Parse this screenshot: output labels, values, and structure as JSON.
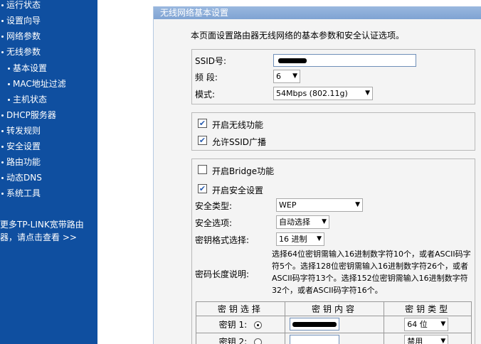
{
  "sidebar": {
    "items": [
      {
        "label": "运行状态"
      },
      {
        "label": "设置向导"
      },
      {
        "label": "网络参数"
      },
      {
        "label": "无线参数"
      },
      {
        "label": "基本设置"
      },
      {
        "label": "MAC地址过滤"
      },
      {
        "label": "主机状态"
      },
      {
        "label": "DHCP服务器"
      },
      {
        "label": "转发规则"
      },
      {
        "label": "安全设置"
      },
      {
        "label": "路由功能"
      },
      {
        "label": "动态DNS"
      },
      {
        "label": "系统工具"
      }
    ],
    "promo_line1": "更多TP-LINK宽带路由",
    "promo_line2": "器，请点击查看 >>"
  },
  "panel": {
    "title": "无线网络基本设置",
    "intro": "本页面设置路由器无线网络的基本参数和安全认证选项。",
    "ssid_label": "SSID号:",
    "ssid_value": "",
    "channel_label": "频 段:",
    "channel_value": "6",
    "mode_label": "模式:",
    "mode_value": "54Mbps (802.11g)",
    "enable_wireless_label": "开启无线功能",
    "enable_wireless_checked": true,
    "ssid_broadcast_label": "允许SSID广播",
    "ssid_broadcast_checked": true,
    "bridge_label": "开启Bridge功能",
    "bridge_checked": false,
    "security_label": "开启安全设置",
    "security_checked": true,
    "security_type_label": "安全类型:",
    "security_type_value": "WEP",
    "security_option_label": "安全选项:",
    "security_option_value": "自动选择",
    "key_format_label": "密钥格式选择:",
    "key_format_value": "16 进制",
    "key_length_label": "密码长度说明:",
    "key_length_desc": "选择64位密钥需输入16进制数字符10个，或者ASCII码字符5个。选择128位密钥需输入16进制数字符26个，或者ASCII码字符13个。选择152位密钥需输入16进制数字符32个，或者ASCII码字符16个。",
    "key_table": {
      "col_select": "密钥选择",
      "col_content": "密钥内容",
      "col_type": "密钥类型",
      "rows": [
        {
          "label": "密钥 1:",
          "selected": true,
          "type": "64 位"
        },
        {
          "label": "密钥 2:",
          "selected": false,
          "type": "禁用"
        }
      ]
    }
  },
  "icons": {
    "checkbox_checked": "checkmark-icon",
    "dropdown": "triangle-down-icon"
  }
}
